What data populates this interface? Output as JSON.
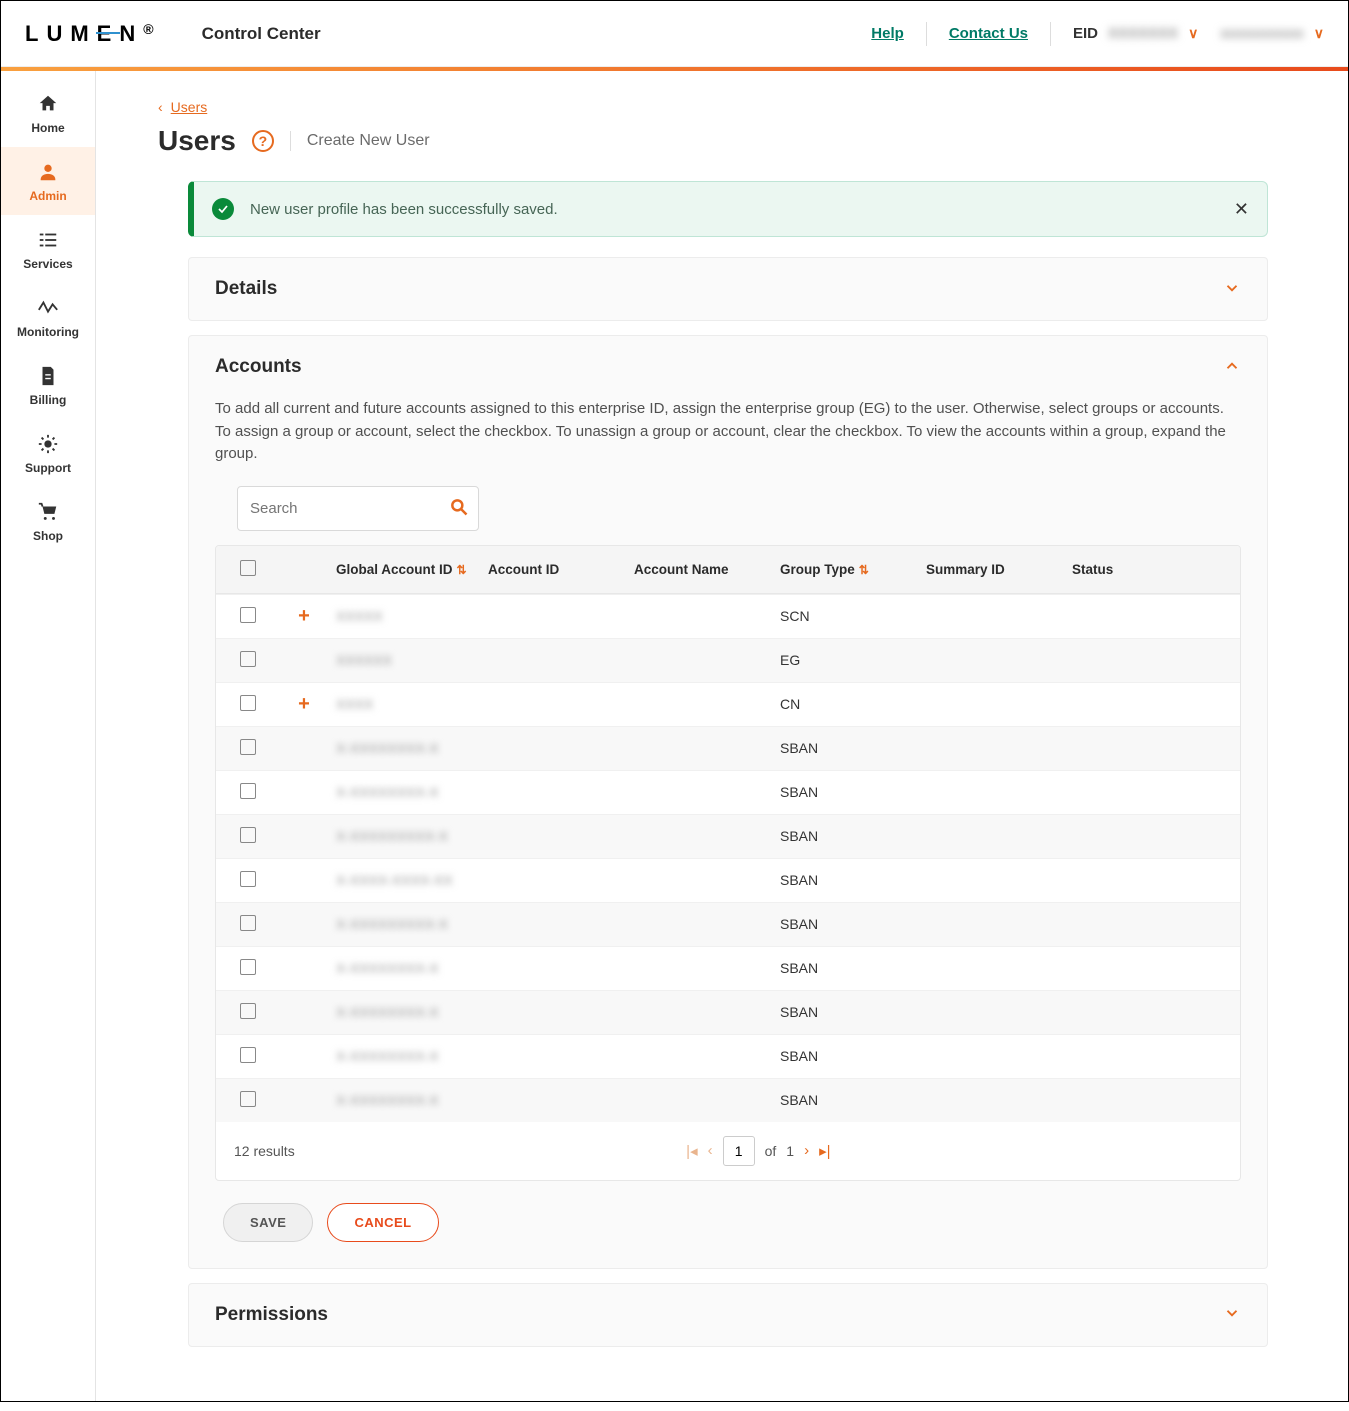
{
  "header": {
    "logo_text": "LUMEN",
    "app_title": "Control Center",
    "links": {
      "help": "Help",
      "contact": "Contact Us"
    },
    "eid_label": "EID",
    "eid_value": "XXXXXXX",
    "username": "xxxxxxxxxx"
  },
  "sidebar": {
    "items": [
      {
        "label": "Home"
      },
      {
        "label": "Admin"
      },
      {
        "label": "Services"
      },
      {
        "label": "Monitoring"
      },
      {
        "label": "Billing"
      },
      {
        "label": "Support"
      },
      {
        "label": "Shop"
      }
    ]
  },
  "breadcrumb": {
    "label": "Users"
  },
  "page": {
    "title": "Users",
    "create_link": "Create New User"
  },
  "alert": {
    "message": "New user profile has been successfully saved."
  },
  "panels": {
    "details": "Details",
    "accounts": "Accounts",
    "permissions": "Permissions"
  },
  "accounts": {
    "description": "To add all current and future accounts assigned to this enterprise ID, assign the enterprise group (EG) to the user. Otherwise, select groups or accounts. To assign a group or account, select the checkbox. To unassign a group or account, clear the checkbox. To view the accounts within a group, expand the group.",
    "search_placeholder": "Search",
    "columns": {
      "global_account_id": "Global Account ID",
      "account_id": "Account ID",
      "account_name": "Account Name",
      "group_type": "Group Type",
      "summary_id": "Summary ID",
      "status": "Status"
    },
    "rows": [
      {
        "expandable": true,
        "gaid": "XXXXX",
        "group_type": "SCN"
      },
      {
        "expandable": false,
        "gaid": "XXXXXX",
        "group_type": "EG"
      },
      {
        "expandable": true,
        "gaid": "XXXX",
        "group_type": "CN"
      },
      {
        "expandable": false,
        "gaid": "X-XXXXXXXX-X",
        "group_type": "SBAN"
      },
      {
        "expandable": false,
        "gaid": "X-XXXXXXXX-X",
        "group_type": "SBAN"
      },
      {
        "expandable": false,
        "gaid": "X-XXXXXXXXX-X",
        "group_type": "SBAN"
      },
      {
        "expandable": false,
        "gaid": "X-XXXX-XXXX-XX",
        "group_type": "SBAN"
      },
      {
        "expandable": false,
        "gaid": "X-XXXXXXXXX-X",
        "group_type": "SBAN"
      },
      {
        "expandable": false,
        "gaid": "X-XXXXXXXX-X",
        "group_type": "SBAN"
      },
      {
        "expandable": false,
        "gaid": "X-XXXXXXXX-X",
        "group_type": "SBAN"
      },
      {
        "expandable": false,
        "gaid": "X-XXXXXXXX-X",
        "group_type": "SBAN"
      },
      {
        "expandable": false,
        "gaid": "X-XXXXXXXX-X",
        "group_type": "SBAN"
      }
    ],
    "results_text": "12 results",
    "pagination": {
      "page": "1",
      "of_label": "of",
      "total": "1"
    },
    "buttons": {
      "save": "SAVE",
      "cancel": "CANCEL"
    }
  }
}
